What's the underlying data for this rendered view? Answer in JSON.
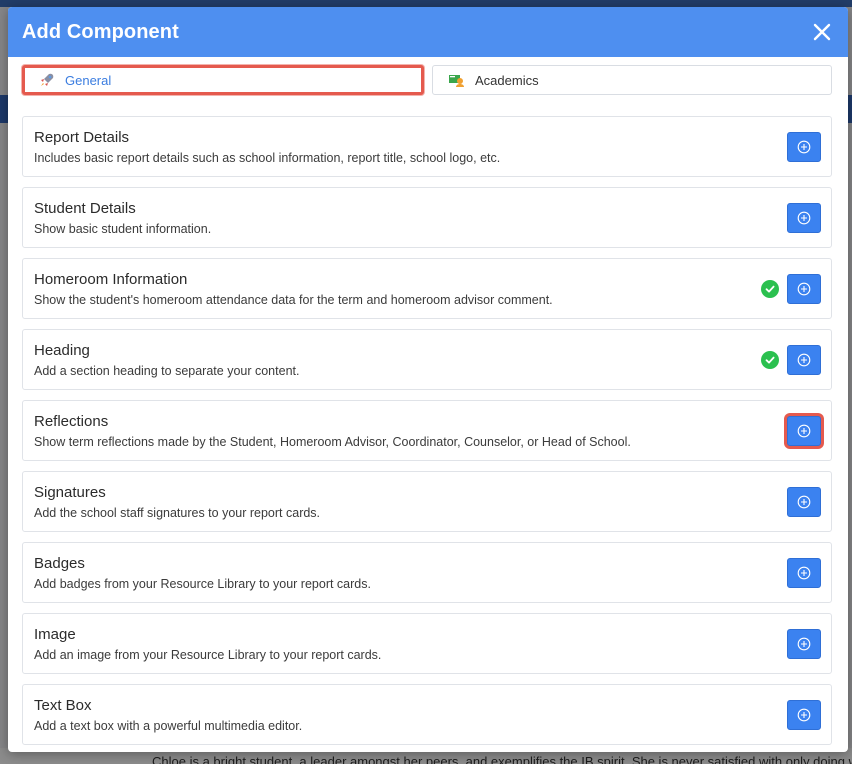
{
  "modal": {
    "title": "Add Component"
  },
  "tabs": [
    {
      "label": "General",
      "icon": "rocket-icon",
      "active": true
    },
    {
      "label": "Academics",
      "icon": "graduation-icon",
      "active": false
    }
  ],
  "components": [
    {
      "title": "Report Details",
      "description": "Includes basic report details such as school information, report title, school logo, etc.",
      "added": false
    },
    {
      "title": "Student Details",
      "description": "Show basic student information.",
      "added": false
    },
    {
      "title": "Homeroom Information",
      "description": "Show the student's homeroom attendance data for the term and homeroom advisor comment.",
      "added": true
    },
    {
      "title": "Heading",
      "description": "Add a section heading to separate your content.",
      "added": true
    },
    {
      "title": "Reflections",
      "description": "Show term reflections made by the Student, Homeroom Advisor, Coordinator, Counselor, or Head of School.",
      "added": false,
      "highlighted": true
    },
    {
      "title": "Signatures",
      "description": "Add the school staff signatures to your report cards.",
      "added": false
    },
    {
      "title": "Badges",
      "description": "Add badges from your Resource Library to your report cards.",
      "added": false
    },
    {
      "title": "Image",
      "description": "Add an image from your Resource Library to your report cards.",
      "added": false
    },
    {
      "title": "Text Box",
      "description": "Add a text box with a powerful multimedia editor.",
      "added": false
    }
  ],
  "background_text": "Chloe is a bright student, a leader amongst her peers, and exemplifies the IB spirit. She is never satisfied with only doing w",
  "colors": {
    "header": "#4e8ff0",
    "add_button": "#3b82f0",
    "check": "#2bc04f",
    "highlight": "#e55a4e"
  }
}
